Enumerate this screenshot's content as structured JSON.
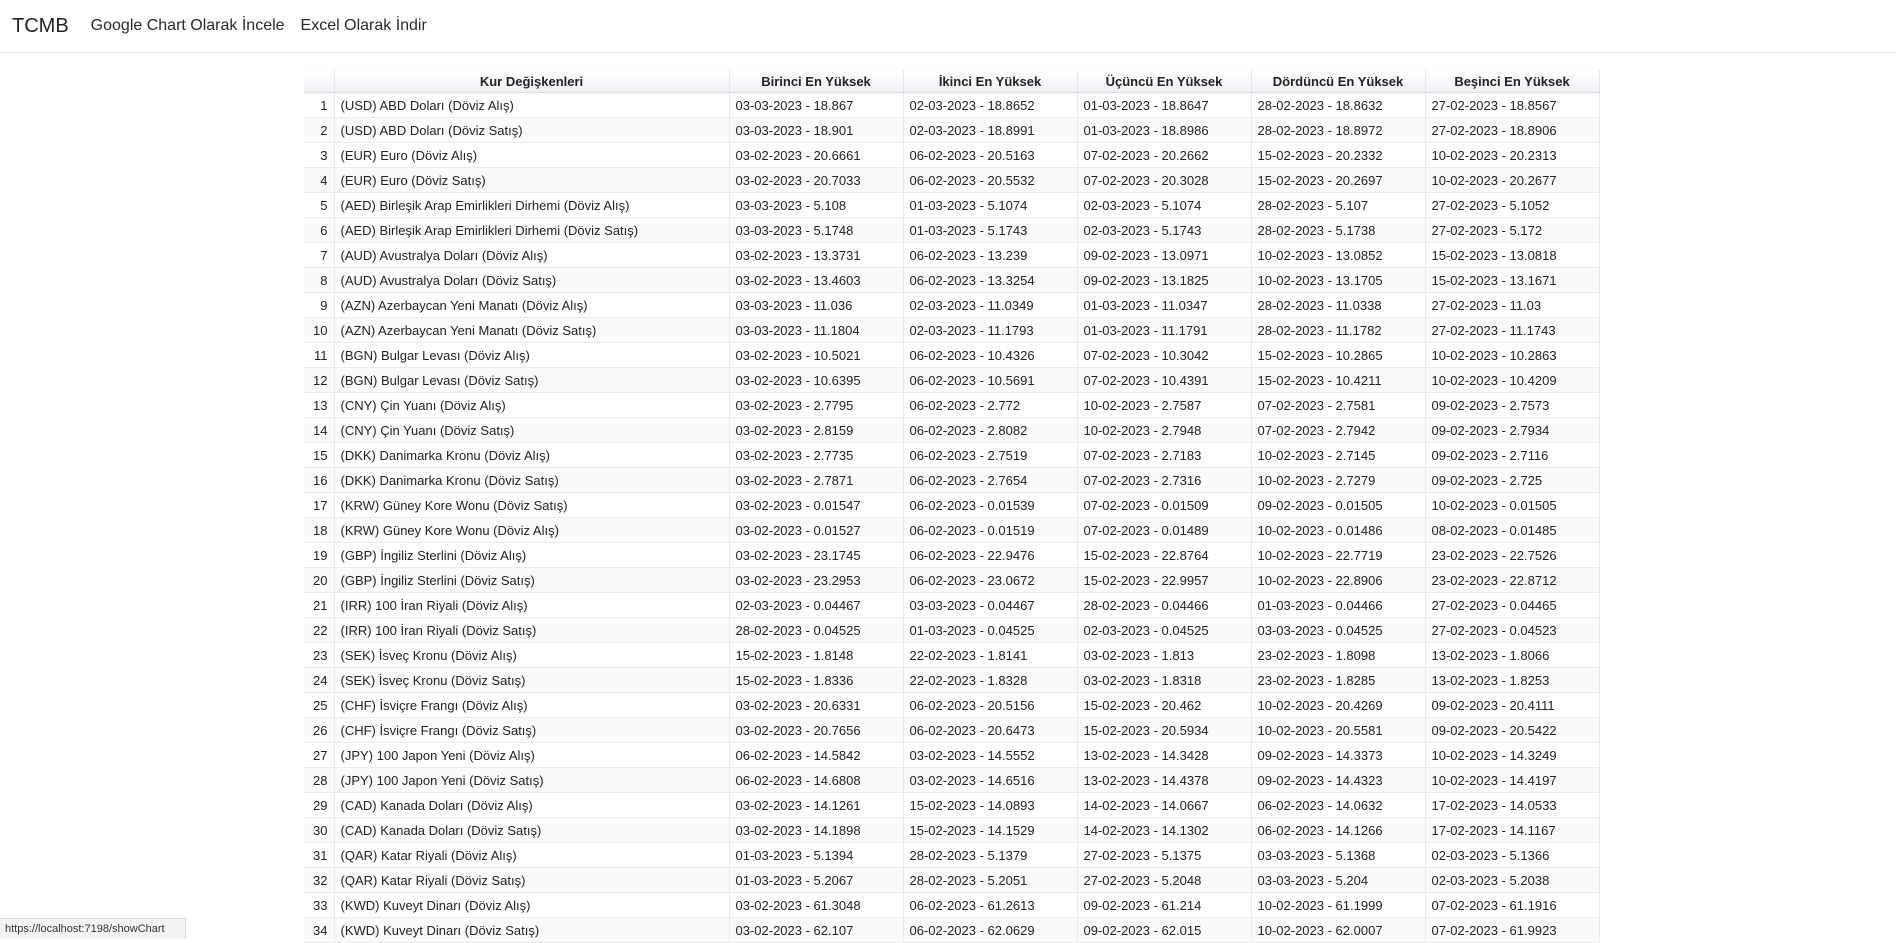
{
  "navbar": {
    "brand": "TCMB",
    "links": [
      "Google Chart Olarak İncele",
      "Excel Olarak İndir"
    ]
  },
  "table": {
    "headers": [
      "",
      "Kur Değişkenleri",
      "Birinci En Yüksek",
      "İkinci En Yüksek",
      "Üçüncü En Yüksek",
      "Dördüncü En Yüksek",
      "Beşinci En Yüksek"
    ],
    "rows": [
      [
        "1",
        "(USD) ABD Doları (Döviz Alış)",
        "03-03-2023 - 18.867",
        "02-03-2023 - 18.8652",
        "01-03-2023 - 18.8647",
        "28-02-2023 - 18.8632",
        "27-02-2023 - 18.8567"
      ],
      [
        "2",
        "(USD) ABD Doları (Döviz Satış)",
        "03-03-2023 - 18.901",
        "02-03-2023 - 18.8991",
        "01-03-2023 - 18.8986",
        "28-02-2023 - 18.8972",
        "27-02-2023 - 18.8906"
      ],
      [
        "3",
        "(EUR) Euro (Döviz Alış)",
        "03-02-2023 - 20.6661",
        "06-02-2023 - 20.5163",
        "07-02-2023 - 20.2662",
        "15-02-2023 - 20.2332",
        "10-02-2023 - 20.2313"
      ],
      [
        "4",
        "(EUR) Euro (Döviz Satış)",
        "03-02-2023 - 20.7033",
        "06-02-2023 - 20.5532",
        "07-02-2023 - 20.3028",
        "15-02-2023 - 20.2697",
        "10-02-2023 - 20.2677"
      ],
      [
        "5",
        "(AED) Birleşik Arap Emirlikleri Dirhemi (Döviz Alış)",
        "03-03-2023 - 5.108",
        "01-03-2023 - 5.1074",
        "02-03-2023 - 5.1074",
        "28-02-2023 - 5.107",
        "27-02-2023 - 5.1052"
      ],
      [
        "6",
        "(AED) Birleşik Arap Emirlikleri Dirhemi (Döviz Satış)",
        "03-03-2023 - 5.1748",
        "01-03-2023 - 5.1743",
        "02-03-2023 - 5.1743",
        "28-02-2023 - 5.1738",
        "27-02-2023 - 5.172"
      ],
      [
        "7",
        "(AUD) Avustralya Doları (Döviz Alış)",
        "03-02-2023 - 13.3731",
        "06-02-2023 - 13.239",
        "09-02-2023 - 13.0971",
        "10-02-2023 - 13.0852",
        "15-02-2023 - 13.0818"
      ],
      [
        "8",
        "(AUD) Avustralya Doları (Döviz Satış)",
        "03-02-2023 - 13.4603",
        "06-02-2023 - 13.3254",
        "09-02-2023 - 13.1825",
        "10-02-2023 - 13.1705",
        "15-02-2023 - 13.1671"
      ],
      [
        "9",
        "(AZN) Azerbaycan Yeni Manatı (Döviz Alış)",
        "03-03-2023 - 11.036",
        "02-03-2023 - 11.0349",
        "01-03-2023 - 11.0347",
        "28-02-2023 - 11.0338",
        "27-02-2023 - 11.03"
      ],
      [
        "10",
        "(AZN) Azerbaycan Yeni Manatı (Döviz Satış)",
        "03-03-2023 - 11.1804",
        "02-03-2023 - 11.1793",
        "01-03-2023 - 11.1791",
        "28-02-2023 - 11.1782",
        "27-02-2023 - 11.1743"
      ],
      [
        "11",
        "(BGN) Bulgar Levası (Döviz Alış)",
        "03-02-2023 - 10.5021",
        "06-02-2023 - 10.4326",
        "07-02-2023 - 10.3042",
        "15-02-2023 - 10.2865",
        "10-02-2023 - 10.2863"
      ],
      [
        "12",
        "(BGN) Bulgar Levası (Döviz Satış)",
        "03-02-2023 - 10.6395",
        "06-02-2023 - 10.5691",
        "07-02-2023 - 10.4391",
        "15-02-2023 - 10.4211",
        "10-02-2023 - 10.4209"
      ],
      [
        "13",
        "(CNY) Çin Yuanı (Döviz Alış)",
        "03-02-2023 - 2.7795",
        "06-02-2023 - 2.772",
        "10-02-2023 - 2.7587",
        "07-02-2023 - 2.7581",
        "09-02-2023 - 2.7573"
      ],
      [
        "14",
        "(CNY) Çin Yuanı (Döviz Satış)",
        "03-02-2023 - 2.8159",
        "06-02-2023 - 2.8082",
        "10-02-2023 - 2.7948",
        "07-02-2023 - 2.7942",
        "09-02-2023 - 2.7934"
      ],
      [
        "15",
        "(DKK) Danimarka Kronu (Döviz Alış)",
        "03-02-2023 - 2.7735",
        "06-02-2023 - 2.7519",
        "07-02-2023 - 2.7183",
        "10-02-2023 - 2.7145",
        "09-02-2023 - 2.7116"
      ],
      [
        "16",
        "(DKK) Danimarka Kronu (Döviz Satış)",
        "03-02-2023 - 2.7871",
        "06-02-2023 - 2.7654",
        "07-02-2023 - 2.7316",
        "10-02-2023 - 2.7279",
        "09-02-2023 - 2.725"
      ],
      [
        "17",
        "(KRW) Güney Kore Wonu (Döviz Satış)",
        "03-02-2023 - 0.01547",
        "06-02-2023 - 0.01539",
        "07-02-2023 - 0.01509",
        "09-02-2023 - 0.01505",
        "10-02-2023 - 0.01505"
      ],
      [
        "18",
        "(KRW) Güney Kore Wonu (Döviz Alış)",
        "03-02-2023 - 0.01527",
        "06-02-2023 - 0.01519",
        "07-02-2023 - 0.01489",
        "10-02-2023 - 0.01486",
        "08-02-2023 - 0.01485"
      ],
      [
        "19",
        "(GBP) İngiliz Sterlini (Döviz Alış)",
        "03-02-2023 - 23.1745",
        "06-02-2023 - 22.9476",
        "15-02-2023 - 22.8764",
        "10-02-2023 - 22.7719",
        "23-02-2023 - 22.7526"
      ],
      [
        "20",
        "(GBP) İngiliz Sterlini (Döviz Satış)",
        "03-02-2023 - 23.2953",
        "06-02-2023 - 23.0672",
        "15-02-2023 - 22.9957",
        "10-02-2023 - 22.8906",
        "23-02-2023 - 22.8712"
      ],
      [
        "21",
        "(IRR) 100 İran Riyali (Döviz Alış)",
        "02-03-2023 - 0.04467",
        "03-03-2023 - 0.04467",
        "28-02-2023 - 0.04466",
        "01-03-2023 - 0.04466",
        "27-02-2023 - 0.04465"
      ],
      [
        "22",
        "(IRR) 100 İran Riyali (Döviz Satış)",
        "28-02-2023 - 0.04525",
        "01-03-2023 - 0.04525",
        "02-03-2023 - 0.04525",
        "03-03-2023 - 0.04525",
        "27-02-2023 - 0.04523"
      ],
      [
        "23",
        "(SEK) İsveç Kronu (Döviz Alış)",
        "15-02-2023 - 1.8148",
        "22-02-2023 - 1.8141",
        "03-02-2023 - 1.813",
        "23-02-2023 - 1.8098",
        "13-02-2023 - 1.8066"
      ],
      [
        "24",
        "(SEK) İsveç Kronu (Döviz Satış)",
        "15-02-2023 - 1.8336",
        "22-02-2023 - 1.8328",
        "03-02-2023 - 1.8318",
        "23-02-2023 - 1.8285",
        "13-02-2023 - 1.8253"
      ],
      [
        "25",
        "(CHF) İsviçre Frangı (Döviz Alış)",
        "03-02-2023 - 20.6331",
        "06-02-2023 - 20.5156",
        "15-02-2023 - 20.462",
        "10-02-2023 - 20.4269",
        "09-02-2023 - 20.4111"
      ],
      [
        "26",
        "(CHF) İsviçre Frangı (Döviz Satış)",
        "03-02-2023 - 20.7656",
        "06-02-2023 - 20.6473",
        "15-02-2023 - 20.5934",
        "10-02-2023 - 20.5581",
        "09-02-2023 - 20.5422"
      ],
      [
        "27",
        "(JPY) 100 Japon Yeni (Döviz Alış)",
        "06-02-2023 - 14.5842",
        "03-02-2023 - 14.5552",
        "13-02-2023 - 14.3428",
        "09-02-2023 - 14.3373",
        "10-02-2023 - 14.3249"
      ],
      [
        "28",
        "(JPY) 100 Japon Yeni (Döviz Satış)",
        "06-02-2023 - 14.6808",
        "03-02-2023 - 14.6516",
        "13-02-2023 - 14.4378",
        "09-02-2023 - 14.4323",
        "10-02-2023 - 14.4197"
      ],
      [
        "29",
        "(CAD) Kanada Doları (Döviz Alış)",
        "03-02-2023 - 14.1261",
        "15-02-2023 - 14.0893",
        "14-02-2023 - 14.0667",
        "06-02-2023 - 14.0632",
        "17-02-2023 - 14.0533"
      ],
      [
        "30",
        "(CAD) Kanada Doları (Döviz Satış)",
        "03-02-2023 - 14.1898",
        "15-02-2023 - 14.1529",
        "14-02-2023 - 14.1302",
        "06-02-2023 - 14.1266",
        "17-02-2023 - 14.1167"
      ],
      [
        "31",
        "(QAR) Katar Riyali (Döviz Alış)",
        "01-03-2023 - 5.1394",
        "28-02-2023 - 5.1379",
        "27-02-2023 - 5.1375",
        "03-03-2023 - 5.1368",
        "02-03-2023 - 5.1366"
      ],
      [
        "32",
        "(QAR) Katar Riyali (Döviz Satış)",
        "01-03-2023 - 5.2067",
        "28-02-2023 - 5.2051",
        "27-02-2023 - 5.2048",
        "03-03-2023 - 5.204",
        "02-03-2023 - 5.2038"
      ],
      [
        "33",
        "(KWD) Kuveyt Dinarı (Döviz Alış)",
        "03-02-2023 - 61.3048",
        "06-02-2023 - 61.2613",
        "09-02-2023 - 61.214",
        "10-02-2023 - 61.1999",
        "07-02-2023 - 61.1916"
      ],
      [
        "34",
        "(KWD) Kuveyt Dinarı (Döviz Satış)",
        "03-02-2023 - 62.107",
        "06-02-2023 - 62.0629",
        "09-02-2023 - 62.015",
        "10-02-2023 - 62.0007",
        "07-02-2023 - 61.9923"
      ]
    ]
  },
  "status_bar": {
    "url": "https://localhost:7198/showChart"
  }
}
